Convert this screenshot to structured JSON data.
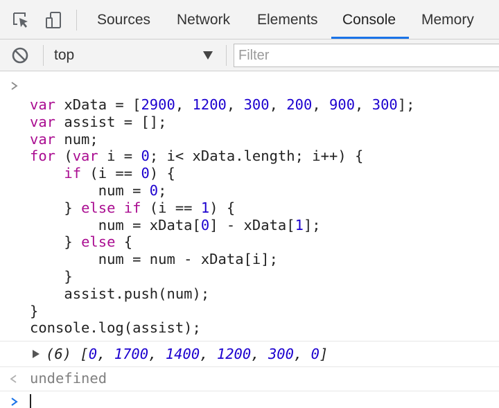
{
  "tabs": {
    "items": [
      {
        "id": "sources",
        "label": "Sources"
      },
      {
        "id": "network",
        "label": "Network"
      },
      {
        "id": "elements",
        "label": "Elements"
      },
      {
        "id": "console",
        "label": "Console",
        "active": true
      },
      {
        "id": "memory",
        "label": "Memory"
      }
    ],
    "active_color": "#1a73e8"
  },
  "toolbar": {
    "icons": [
      "inspect-element-icon",
      "device-toolbar-icon"
    ]
  },
  "console_toolbar": {
    "context": "top",
    "filter_placeholder": "Filter"
  },
  "console": {
    "code_lines": [
      "var xData = [2900, 1200, 300, 200, 900, 300];",
      "var assist = [];",
      "var num;",
      "for (var i = 0; i< xData.length; i++) {",
      "    if (i == 0) {",
      "        num = 0;",
      "    } else if (i == 1) {",
      "        num = xData[0] - xData[1];",
      "    } else {",
      "        num = num - xData[i];",
      "    }",
      "    assist.push(num);",
      "}",
      "console.log(assist);"
    ],
    "result": {
      "count": "(6)",
      "values": [
        0,
        1700,
        1400,
        1200,
        300,
        0
      ]
    },
    "return_value": "undefined"
  },
  "colors": {
    "keyword": "#aa0d91",
    "number": "#1c00cf",
    "prompt": "#1a73e8"
  }
}
